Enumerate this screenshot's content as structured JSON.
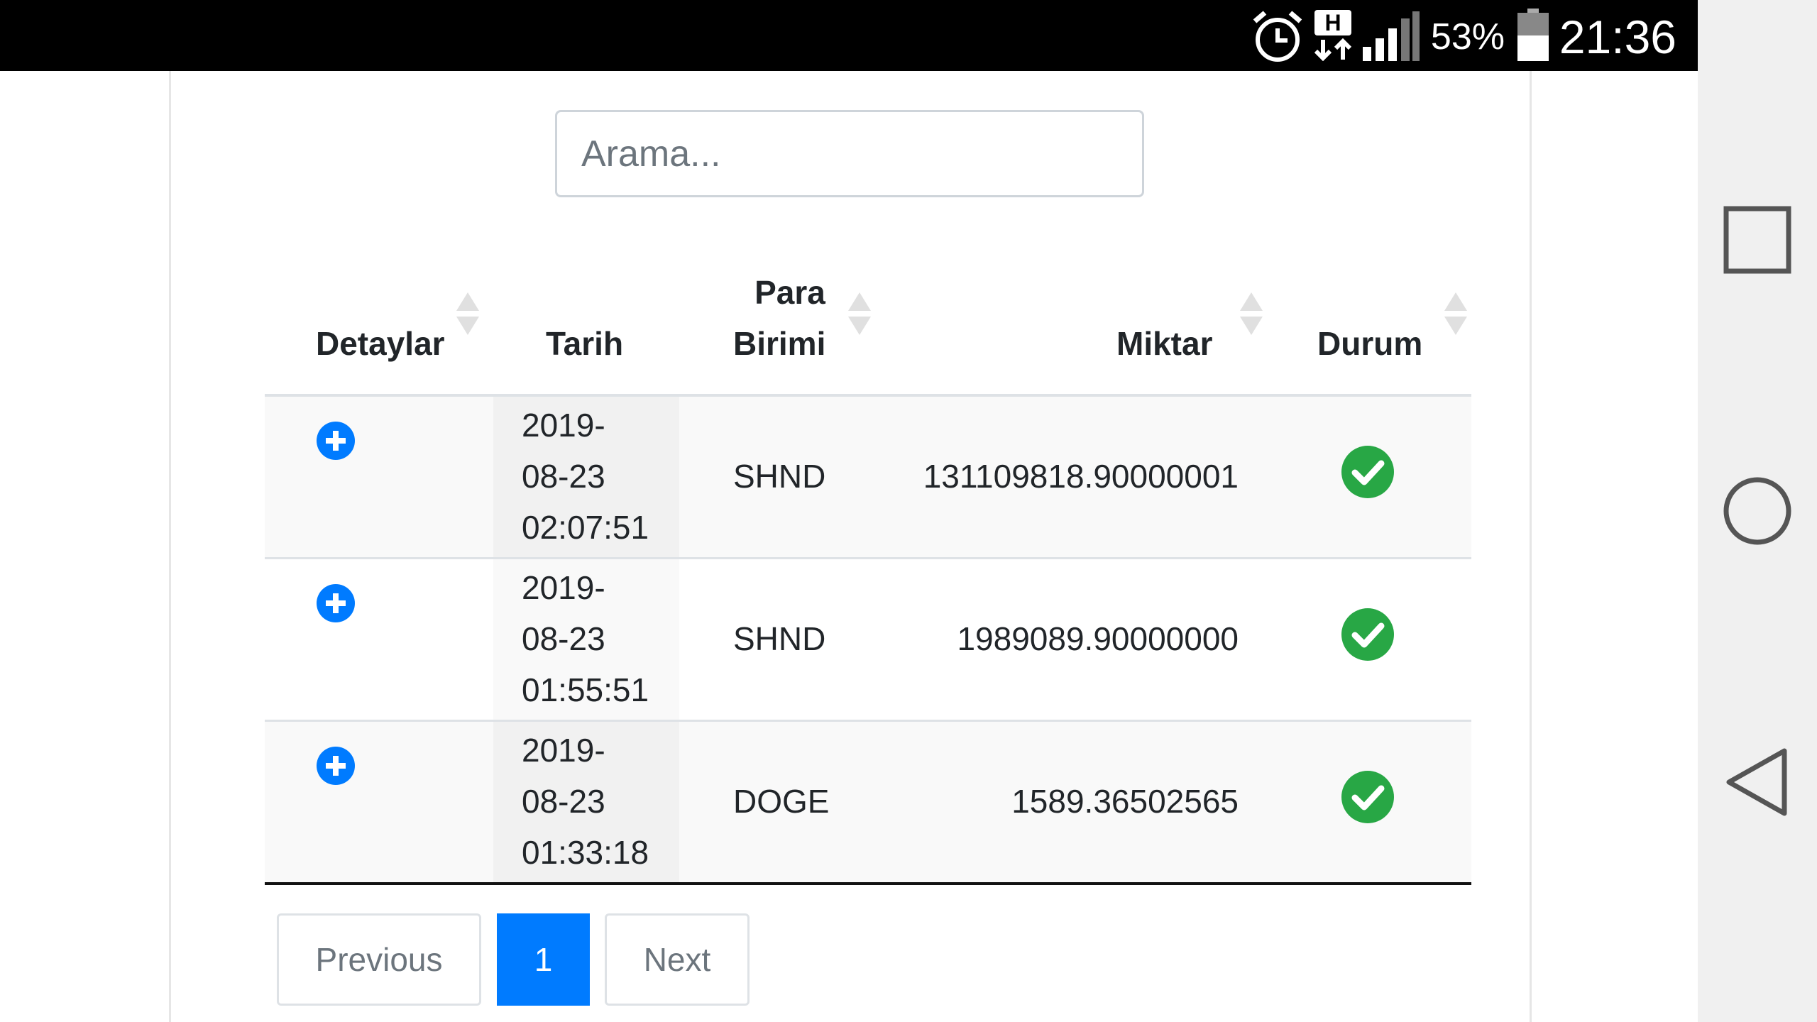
{
  "status_bar": {
    "time": "21:36",
    "battery_percent": "53%",
    "battery_level": 0.53,
    "network_type": "H",
    "icons": [
      "alarm-icon",
      "h-plus-network-icon",
      "signal-icon",
      "battery-icon"
    ]
  },
  "search": {
    "placeholder": "Arama..."
  },
  "table": {
    "columns": [
      "Detaylar",
      "Tarih",
      "Para Birimi",
      "Miktar",
      "Durum"
    ],
    "column_header_lines": {
      "para": "Para",
      "birimi": "Birimi"
    },
    "rows": [
      {
        "date_line1": "2019-",
        "date_line2": "08-23",
        "date_line3": "02:07:51",
        "currency": "SHND",
        "amount": "131109818.90000001",
        "status": "success"
      },
      {
        "date_line1": "2019-",
        "date_line2": "08-23",
        "date_line3": "01:55:51",
        "currency": "SHND",
        "amount": "1989089.90000000",
        "status": "success"
      },
      {
        "date_line1": "2019-",
        "date_line2": "08-23",
        "date_line3": "01:33:18",
        "currency": "DOGE",
        "amount": "1589.36502565",
        "status": "success"
      }
    ]
  },
  "pagination": {
    "previous": "Previous",
    "current_page": "1",
    "next": "Next"
  },
  "colors": {
    "primary": "#007bff",
    "success": "#28a745",
    "status_bar": "#000000"
  },
  "nav_icons": [
    "recents-square-icon",
    "home-circle-icon",
    "back-triangle-icon"
  ]
}
